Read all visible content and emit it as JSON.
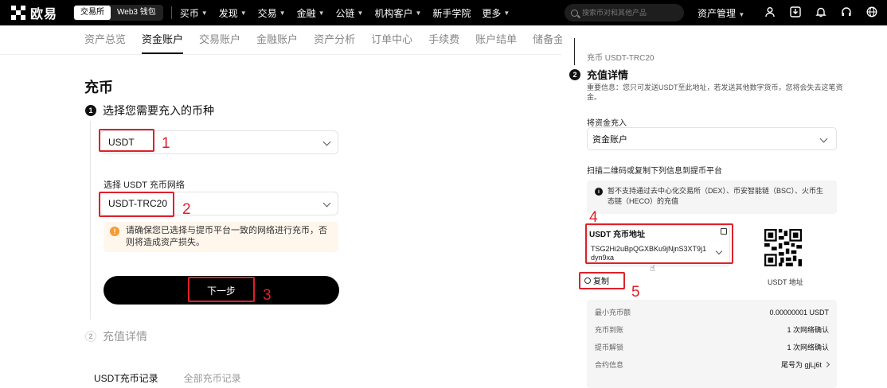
{
  "nav": {
    "logo": "欧易",
    "modes": [
      "交易所",
      "Web3 钱包"
    ],
    "items": [
      "买币",
      "发现",
      "交易",
      "金融",
      "公链",
      "机构客户",
      "新手学院",
      "更多"
    ],
    "search_placeholder": "搜索币对和其他产品",
    "assets": "资产管理"
  },
  "subtabs": [
    "资产总览",
    "资金账户",
    "交易账户",
    "金融账户",
    "资产分析",
    "订单中心",
    "手续费",
    "账户结单",
    "储备金证明报告"
  ],
  "deposit": {
    "title": "充币",
    "step1_num": "1",
    "step1_title": "选择您需要充入的币种",
    "coin": "USDT",
    "network_label": "选择 USDT 充币网络",
    "network": "USDT-TRC20",
    "warning_icon": "!",
    "warning": "请确保您已选择与提币平台一致的网络进行充币，否则将造成资产损失。",
    "next_button": "下一步",
    "step2_num": "2",
    "step2_title": "充值详情",
    "history_tabs": [
      "USDT充币记录",
      "全部充币记录"
    ]
  },
  "annotations": [
    "1",
    "2",
    "3",
    "4",
    "5"
  ],
  "panel": {
    "subtitle": "充币 USDT-TRC20",
    "step_num": "2",
    "title": "充值详情",
    "note": "重要信息：您只可发送USDT至此地址，若发送其他数字货币，您将会失去这笔资金。",
    "deposit_to_label": "将资金充入",
    "deposit_to": "资金账户",
    "scan_label": "扫描二维码或复制下列信息到提币平台",
    "info_icon": "i",
    "info_text": "暂不支持通过去中心化交易所（DEX）、币安智能链（BSC）、火币生态链（HECO）的充值",
    "address_label": "USDT 充币地址",
    "address": "TSG2Hi2uBpQGXBKu9jNjnS3XT9j1dyn9xa",
    "copy": "复制",
    "qr_label": "USDT 地址",
    "details": [
      {
        "k": "最小充币额",
        "v": "0.00000001 USDT"
      },
      {
        "k": "充币到账",
        "v": "1 次网络确认"
      },
      {
        "k": "提币解锁",
        "v": "1 次网络确认"
      },
      {
        "k": "合约信息",
        "v": "尾号为 gjLj6t"
      }
    ]
  },
  "colors": {
    "annotation": "#e0202a",
    "warning": "#f39b34"
  }
}
